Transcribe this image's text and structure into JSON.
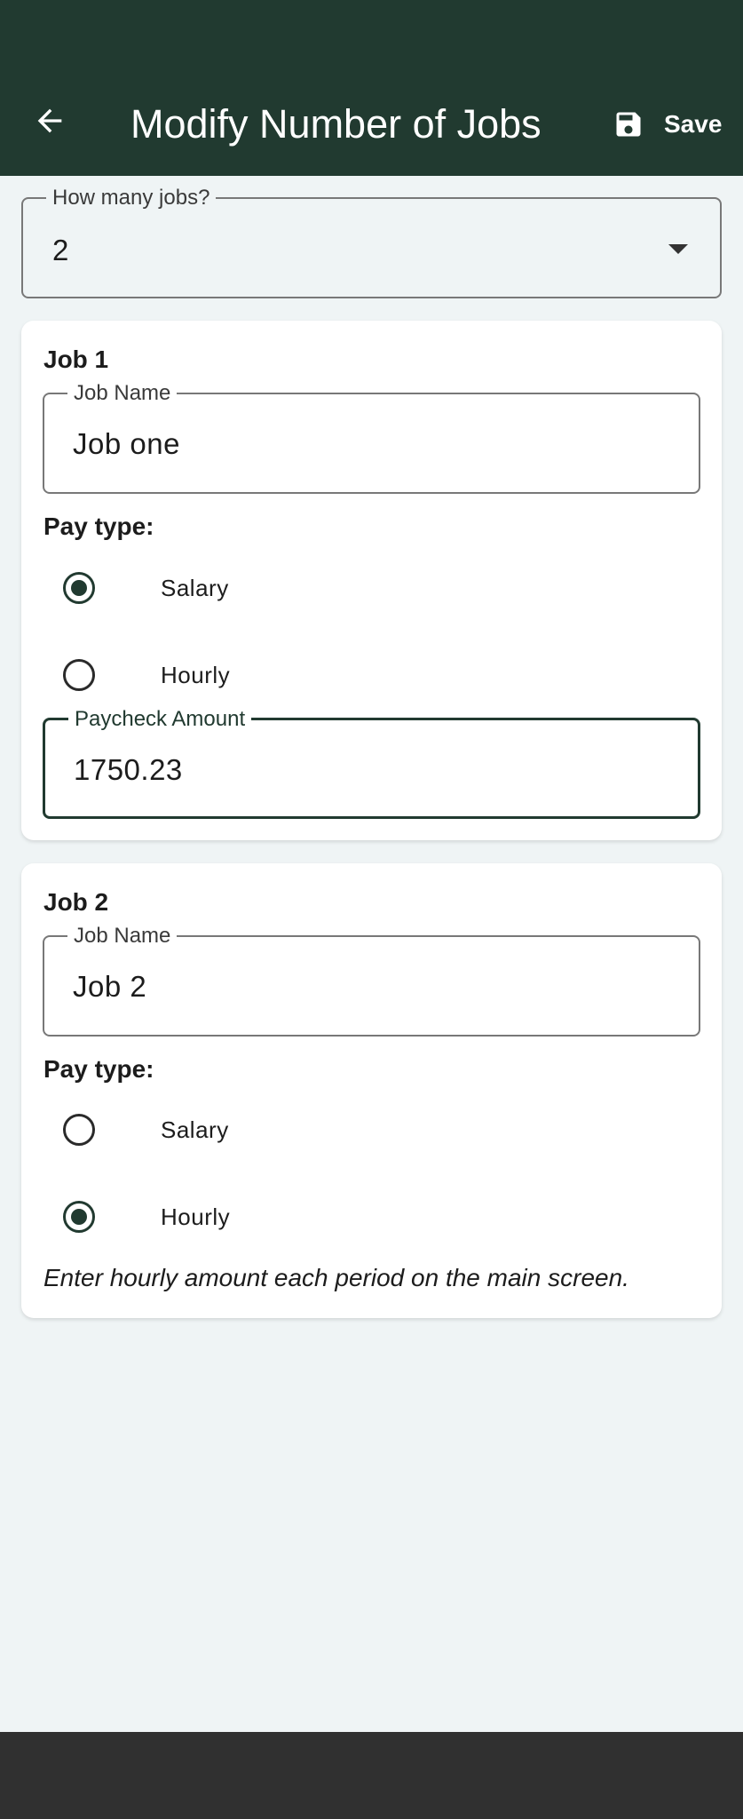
{
  "app_bar": {
    "title": "Modify Number of Jobs",
    "back_icon": "arrow-left-icon",
    "save_icon": "floppy-disk-icon",
    "save_label": "Save",
    "color": "#213a30"
  },
  "jobs_select": {
    "label": "How many jobs?",
    "value": "2"
  },
  "jobs": [
    {
      "heading": "Job 1",
      "name_label": "Job Name",
      "name_value": "Job one",
      "pay_type_label": "Pay type:",
      "options": [
        "Salary",
        "Hourly"
      ],
      "selected": "Salary",
      "amount_label": "Paycheck Amount",
      "amount_value": "1750.23"
    },
    {
      "heading": "Job 2",
      "name_label": "Job Name",
      "name_value": "Job 2",
      "pay_type_label": "Pay type:",
      "options": [
        "Salary",
        "Hourly"
      ],
      "selected": "Hourly",
      "note": "Enter hourly amount each period on the main screen."
    }
  ]
}
